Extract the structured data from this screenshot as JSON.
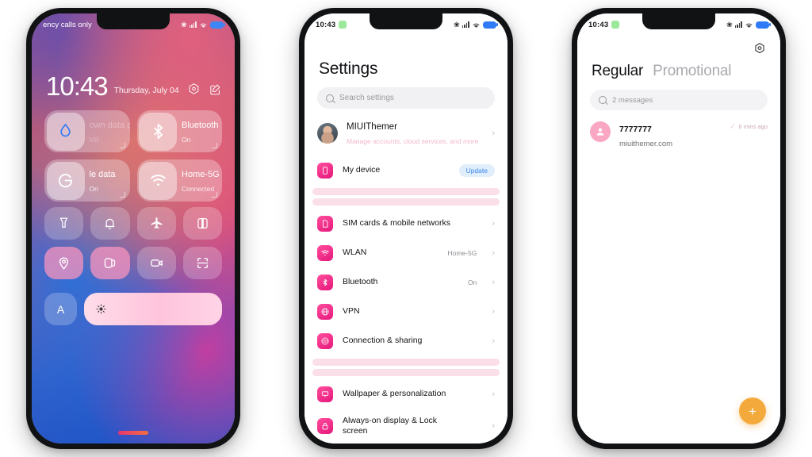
{
  "phone1": {
    "name": "lockscreen-control-center",
    "statusbar": {
      "carrier": "ency calls only",
      "bluetooth_icon": "bluetooth-icon",
      "signal_icon": "signal-bars-icon",
      "wifi_icon": "wifi-icon",
      "battery_icon": "battery-icon"
    },
    "clock": {
      "time": "10:43",
      "date": "Thursday, July 04"
    },
    "actions": [
      {
        "name": "camera-shortcut-icon",
        "icon": "hexagon-camera-icon"
      },
      {
        "name": "notes-shortcut-icon",
        "icon": "edit-note-icon"
      }
    ],
    "tiles": [
      {
        "title": "own data phe",
        "subtitle": "MB",
        "icon": "water-drop-icon",
        "state": "dim"
      },
      {
        "title": "Bluetooth",
        "subtitle": "On",
        "icon": "bluetooth-icon",
        "state": "on"
      },
      {
        "title": "le data",
        "subtitle": "On",
        "icon": "mobile-data-icon",
        "state": "on"
      },
      {
        "title": "Home-5G",
        "subtitle": "Connected",
        "icon": "wifi-icon",
        "state": "on"
      }
    ],
    "grid": [
      {
        "icon": "flashlight-icon",
        "on": false
      },
      {
        "icon": "alarm-bell-icon",
        "on": false
      },
      {
        "icon": "airplane-mode-icon",
        "on": false
      },
      {
        "icon": "split-screen-icon",
        "on": false
      },
      {
        "icon": "location-icon",
        "on": true
      },
      {
        "icon": "screenshot-icon",
        "on": true
      },
      {
        "icon": "screen-record-icon",
        "on": false
      },
      {
        "icon": "scanner-icon",
        "on": false
      }
    ],
    "brightness": {
      "auto_label": "A",
      "icon": "brightness-sun-icon",
      "level": 100
    }
  },
  "phone2": {
    "name": "settings-app",
    "statusbar": {
      "time": "10:43"
    },
    "title": "Settings",
    "search": {
      "placeholder": "Search settings",
      "icon": "search-icon"
    },
    "account": {
      "name": "MIUIThemer",
      "subtitle": "Manage accounts, cloud services, and more",
      "avatar": "user-photo-avatar"
    },
    "device_row": {
      "label": "My device",
      "badge": "Update",
      "icon": "device-icon"
    },
    "group_a": [
      {
        "label": "SIM cards & mobile networks",
        "value": "",
        "icon": "sim-card-icon"
      },
      {
        "label": "WLAN",
        "value": "Home-5G",
        "icon": "wifi-icon"
      },
      {
        "label": "Bluetooth",
        "value": "On",
        "icon": "bluetooth-icon"
      },
      {
        "label": "VPN",
        "value": "",
        "icon": "globe-icon"
      },
      {
        "label": "Connection & sharing",
        "value": "",
        "icon": "connection-sharing-icon"
      }
    ],
    "group_b": [
      {
        "label": "Wallpaper & personalization",
        "value": "",
        "icon": "wallpaper-icon"
      },
      {
        "label": "Always-on display & Lock screen",
        "value": "",
        "icon": "lock-icon"
      }
    ]
  },
  "phone3": {
    "name": "messages-app",
    "statusbar": {
      "time": "10:43"
    },
    "settings_icon": "gear-icon",
    "tabs": [
      {
        "label": "Regular",
        "active": true
      },
      {
        "label": "Promotional",
        "active": false
      }
    ],
    "search": {
      "placeholder": "2 messages",
      "icon": "search-icon"
    },
    "messages": [
      {
        "sender": "7777777",
        "preview": "miuithemer.com",
        "time": "6 mins ago",
        "avatar": "person-avatar-icon",
        "status_icon": "pencil-icon"
      }
    ],
    "fab": {
      "label": "+",
      "name": "new-message-fab"
    }
  },
  "colors": {
    "accent_pink": "#e6187c",
    "fab_orange": "#f3a93c",
    "update_blue": "#3f86e8",
    "separator_pink": "#fbdfe8",
    "background": "#ffffff"
  }
}
